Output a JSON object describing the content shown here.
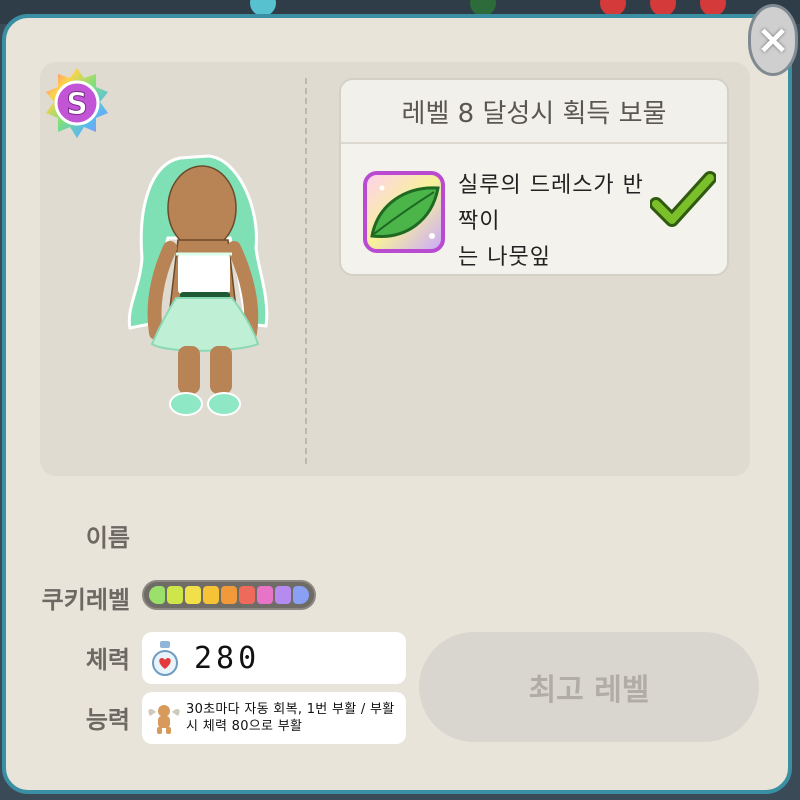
{
  "colors": {
    "frame": "#3a8fa3",
    "panel": "#e9e4da",
    "showcase": "#dfdbd0",
    "label": "#6d6862",
    "check": "#7bbf2a",
    "mint_hair": "#7fe0b6",
    "skin": "#b88455"
  },
  "close_button": {
    "label": "×",
    "icon": "close-icon"
  },
  "grade_badge": {
    "letter": "S",
    "icon": "rainbow-star-badge"
  },
  "reward": {
    "title": "레벨 8 달성시 획득 보물",
    "item_icon": "leaf-treasure-icon",
    "description_line1": "실루의 드레스가 반짝이",
    "description_line2": "는 나뭇잎",
    "status_icon": "check-icon"
  },
  "stats": {
    "name_label": "이름",
    "name_value": "",
    "level_label": "쿠키레벨",
    "level_segments": [
      "#9be06a",
      "#cfe64a",
      "#f2e04a",
      "#f6c236",
      "#f29a3a",
      "#ee6a5a",
      "#e874c8",
      "#b58bf0",
      "#8aa0f5"
    ],
    "hp_label": "체력",
    "hp_icon": "heart-potion-icon",
    "hp_value": "280",
    "ability_label": "능력",
    "ability_icon": "cookie-angel-icon",
    "ability_text": "30초마다 자동 회복, 1번 부활 / 부활시 체력 80으로 부활"
  },
  "max_level_button": {
    "label": "최고 레벨"
  }
}
